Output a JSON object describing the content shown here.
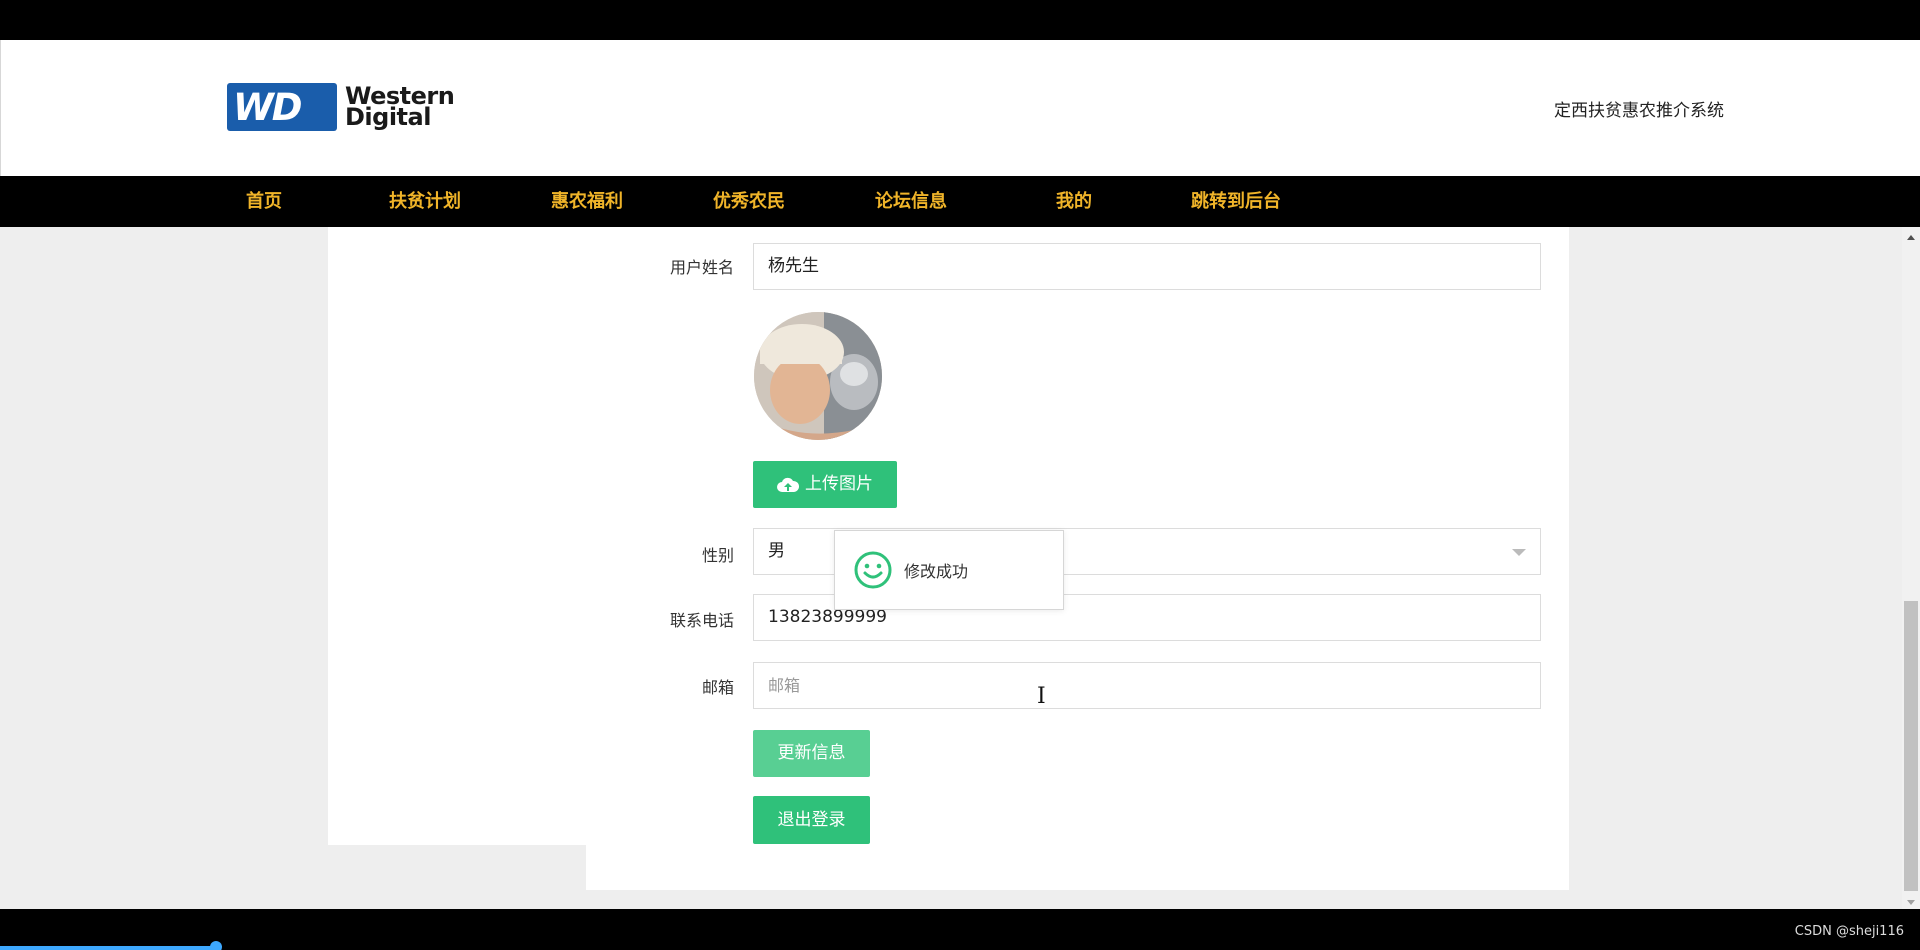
{
  "header": {
    "logo_text_line1": "Western",
    "logo_text_line2": "Digital",
    "logo_mark": "WD",
    "site_title": "定西扶贫惠农推介系统"
  },
  "nav": {
    "items": [
      "首页",
      "扶贫计划",
      "惠农福利",
      "优秀农民",
      "论坛信息",
      "我的",
      "跳转到后台"
    ]
  },
  "form": {
    "username_label": "用户姓名",
    "username_value": "杨先生",
    "upload_button": "上传图片",
    "upload_icon": "cloud-upload-icon",
    "gender_label": "性别",
    "gender_value": "男",
    "phone_label": "联系电话",
    "phone_value": "13823899999",
    "email_label": "邮箱",
    "email_placeholder": "邮箱",
    "update_button": "更新信息",
    "logout_button": "退出登录"
  },
  "toast": {
    "icon": "smile-icon",
    "message": "修改成功"
  },
  "footer": {
    "watermark": "CSDN @sheji116"
  },
  "colors": {
    "nav_text": "#f0b429",
    "button": "#2fc17a",
    "logo": "#1a5dab"
  }
}
